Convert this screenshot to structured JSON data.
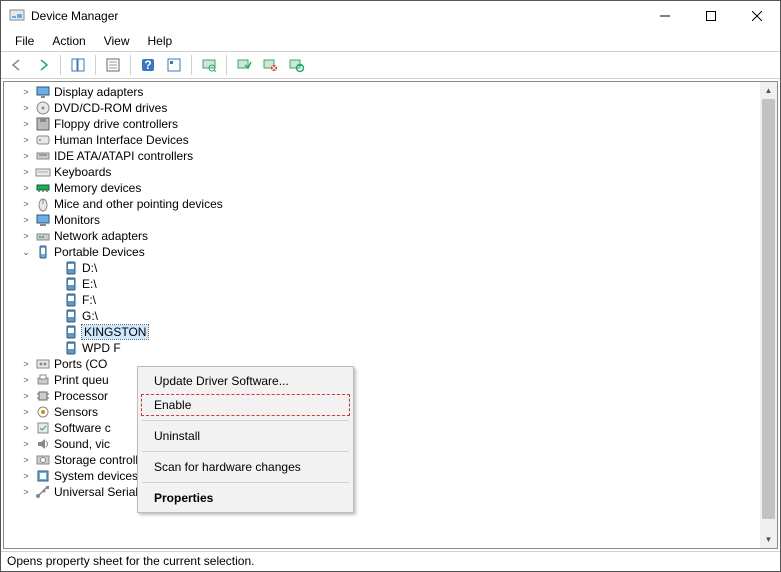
{
  "window": {
    "title": "Device Manager"
  },
  "menus": [
    "File",
    "Action",
    "View",
    "Help"
  ],
  "toolbar_icons": [
    "back-icon",
    "forward-icon",
    "sep",
    "show-hide-tree-icon",
    "sep",
    "properties-icon",
    "sep",
    "help-icon",
    "properties2-icon",
    "sep",
    "scan-icon",
    "sep",
    "enable-icon",
    "disable-icon",
    "update-driver-icon"
  ],
  "tree": [
    {
      "label": "Display adapters",
      "icon": "display",
      "expand": "collapsed"
    },
    {
      "label": "DVD/CD-ROM drives",
      "icon": "disc",
      "expand": "collapsed"
    },
    {
      "label": "Floppy drive controllers",
      "icon": "floppy",
      "expand": "collapsed"
    },
    {
      "label": "Human Interface Devices",
      "icon": "hid",
      "expand": "collapsed"
    },
    {
      "label": "IDE ATA/ATAPI controllers",
      "icon": "ide",
      "expand": "collapsed"
    },
    {
      "label": "Keyboards",
      "icon": "keyboard",
      "expand": "collapsed"
    },
    {
      "label": "Memory devices",
      "icon": "memory",
      "expand": "collapsed"
    },
    {
      "label": "Mice and other pointing devices",
      "icon": "mouse",
      "expand": "collapsed"
    },
    {
      "label": "Monitors",
      "icon": "monitor",
      "expand": "collapsed"
    },
    {
      "label": "Network adapters",
      "icon": "network",
      "expand": "collapsed"
    },
    {
      "label": "Portable Devices",
      "icon": "portable",
      "expand": "expanded",
      "children": [
        {
          "label": "D:\\",
          "icon": "pdev"
        },
        {
          "label": "E:\\",
          "icon": "pdev"
        },
        {
          "label": "F:\\",
          "icon": "pdev"
        },
        {
          "label": "G:\\",
          "icon": "pdev"
        },
        {
          "label": "KINGSTON",
          "icon": "pdev",
          "selected": true
        },
        {
          "label": "WPD F",
          "icon": "pdev"
        }
      ]
    },
    {
      "label": "Ports (CO",
      "icon": "ports",
      "expand": "collapsed"
    },
    {
      "label": "Print queu",
      "icon": "printer",
      "expand": "collapsed"
    },
    {
      "label": "Processor",
      "icon": "cpu",
      "expand": "collapsed"
    },
    {
      "label": "Sensors",
      "icon": "sensor",
      "expand": "collapsed"
    },
    {
      "label": "Software c",
      "icon": "swc",
      "expand": "collapsed"
    },
    {
      "label": "Sound, vic",
      "icon": "sound",
      "expand": "collapsed"
    },
    {
      "label": "Storage controllers",
      "icon": "storage",
      "expand": "collapsed"
    },
    {
      "label": "System devices",
      "icon": "system",
      "expand": "collapsed"
    },
    {
      "label": "Universal Serial Bus controllers",
      "icon": "usb",
      "expand": "collapsed"
    }
  ],
  "context_menu": {
    "items": [
      {
        "label": "Update Driver Software...",
        "kind": "normal"
      },
      {
        "label": "Enable",
        "kind": "highlight"
      },
      {
        "sep": true
      },
      {
        "label": "Uninstall",
        "kind": "normal"
      },
      {
        "sep": true
      },
      {
        "label": "Scan for hardware changes",
        "kind": "normal"
      },
      {
        "sep": true
      },
      {
        "label": "Properties",
        "kind": "bold"
      }
    ]
  },
  "status": "Opens property sheet for the current selection."
}
